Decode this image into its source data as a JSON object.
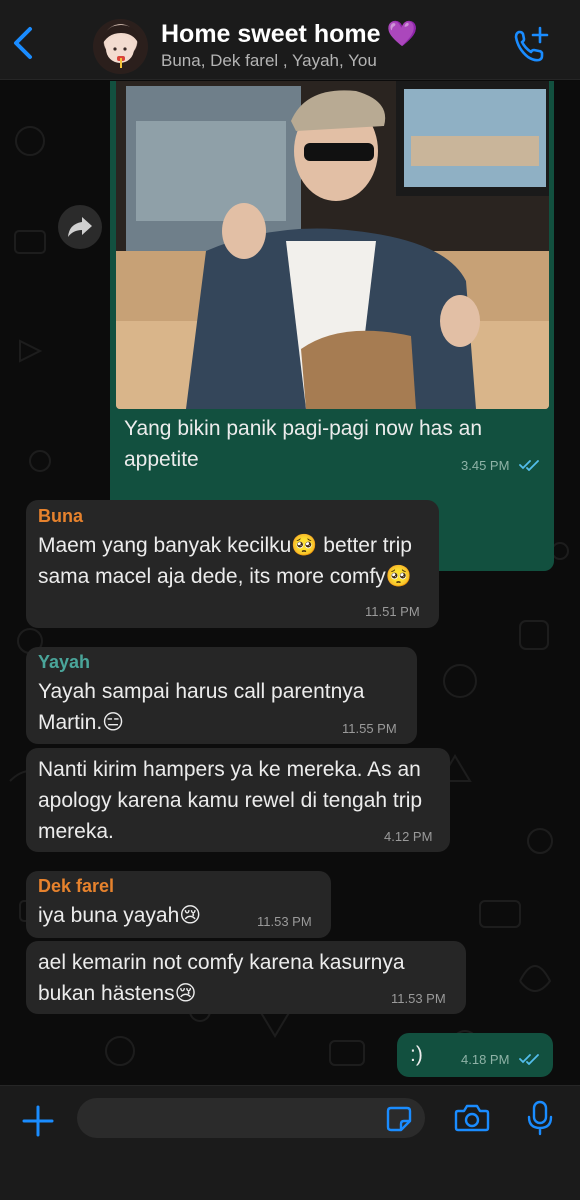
{
  "header": {
    "title": "Home sweet home",
    "title_emoji": "💜",
    "subtitle": "Buna, Dek farel , Yayah, You"
  },
  "colors": {
    "accent": "#1a8cff",
    "outgoing_bubble": "#12503f",
    "incoming_bubble": "#262626",
    "sender_buna": "#e6822d",
    "sender_yayah": "#4aa59a",
    "sender_dek_farel": "#e6822d",
    "read_ticks": "#53bdeb"
  },
  "messages": [
    {
      "id": "m1",
      "direction": "out",
      "has_image": true,
      "text": "Yang bikin panik pagi-pagi now has an appetite",
      "time": "3.45 PM",
      "read": true
    },
    {
      "id": "m2",
      "direction": "in",
      "sender": "Buna",
      "text": "Maem yang banyak kecilku🥺 better trip sama macel aja dede, its more comfy🥺",
      "time": "11.51 PM"
    },
    {
      "id": "m3",
      "direction": "in",
      "sender": "Yayah",
      "text": "Yayah sampai harus call parentnya Martin.😑",
      "time": "11.55 PM"
    },
    {
      "id": "m4",
      "direction": "in",
      "text": "Nanti kirim hampers ya ke mereka. As an apology karena kamu rewel di tengah trip mereka.",
      "time": "4.12 PM"
    },
    {
      "id": "m5",
      "direction": "in",
      "sender": "Dek farel",
      "text": "iya buna yayah😢",
      "time": "11.53 PM"
    },
    {
      "id": "m6",
      "direction": "in",
      "text": "ael kemarin not comfy karena kasurnya bukan hästens😢",
      "time": "11.53 PM"
    },
    {
      "id": "m7",
      "direction": "out",
      "text": ":)",
      "time": "4.18 PM",
      "read": true
    }
  ],
  "icons": {
    "back": "chevron-left-icon",
    "call": "phone-add-icon",
    "forward": "forward-arrow-icon",
    "plus": "plus-icon",
    "sticker": "sticker-icon",
    "camera": "camera-icon",
    "mic": "microphone-icon"
  }
}
